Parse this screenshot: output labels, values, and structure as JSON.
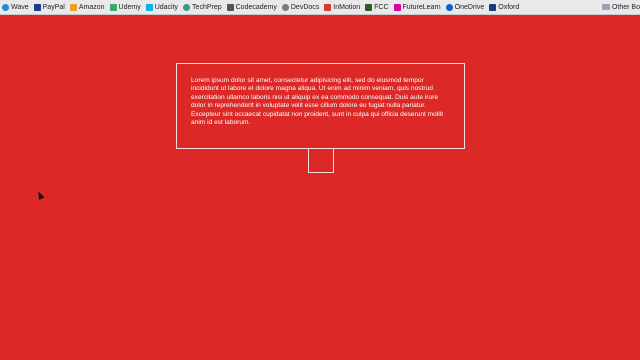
{
  "bookmarks": [
    {
      "label": "Wave",
      "icon": "wave-icon",
      "color": "#1a8fd6",
      "round": true
    },
    {
      "label": "PayPal",
      "icon": "paypal-icon",
      "color": "#1c3c8c",
      "round": false
    },
    {
      "label": "Amazon",
      "icon": "amazon-icon",
      "color": "#f0a020",
      "round": false
    },
    {
      "label": "Udemy",
      "icon": "udemy-icon",
      "color": "#3aa76d",
      "round": false
    },
    {
      "label": "Udacity",
      "icon": "udacity-icon",
      "color": "#02b3e4",
      "round": false
    },
    {
      "label": "TechPrep",
      "icon": "techprep-icon",
      "color": "#2a9d8f",
      "round": true
    },
    {
      "label": "Codecademy",
      "icon": "codecademy-icon",
      "color": "#555555",
      "round": false
    },
    {
      "label": "DevDocs",
      "icon": "devdocs-icon",
      "color": "#7a7a7a",
      "round": true
    },
    {
      "label": "InMotion",
      "icon": "inmotion-icon",
      "color": "#d43b2e",
      "round": false
    },
    {
      "label": "FCC",
      "icon": "fcc-icon",
      "color": "#2f5a2a",
      "round": false
    },
    {
      "label": "FutureLearn",
      "icon": "futurelearn-icon",
      "color": "#de00a5",
      "round": false
    },
    {
      "label": "OneDrive",
      "icon": "onedrive-icon",
      "color": "#0a64c8",
      "round": true
    },
    {
      "label": "Oxford",
      "icon": "oxford-icon",
      "color": "#1e3a7a",
      "round": false
    }
  ],
  "other_bookmarks": "Other Bo",
  "content": {
    "paragraph": "Lorem ipsum dolor sit amet, consectetur adipisicing elit, sed do eiusmod tempor incididunt ut labore et dolore magna aliqua. Ut enim ad minim veniam, quis nostrud exercitation ullamco laboris nisi ut aliquip ex ea commodo consequat. Duis aute irure dolor in reprehenderit in voluptate velit esse cillum dolore eu fugiat nulla pariatur. Excepteur sint occaecat cupidatat non proident, sunt in culpa qui officia deserunt mollit anim id est laborum."
  },
  "colors": {
    "background": "#dc2826",
    "box_border": "#f7dede",
    "text": "#ffffff"
  }
}
